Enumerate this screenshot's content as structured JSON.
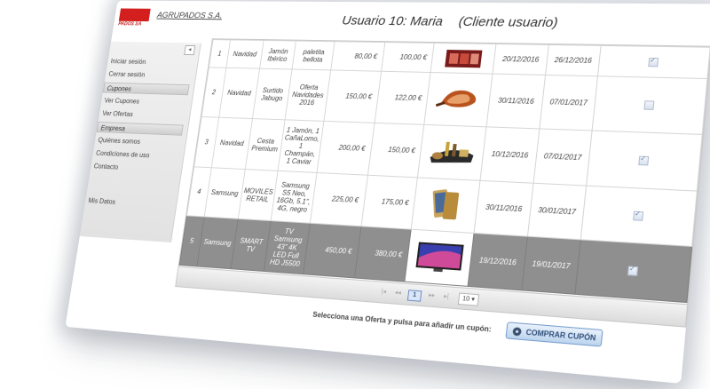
{
  "header": {
    "company": "AGRUPADOS S.A.",
    "logo_sub": "PADOS SA",
    "user": "Usuario 10: Maria",
    "role": "(Cliente usuario)"
  },
  "sidebar": {
    "collapse": "◂",
    "items": [
      {
        "label": "Iniciar sesión"
      },
      {
        "label": "Cerrar sesión"
      },
      {
        "label": "Cupones",
        "header": true
      },
      {
        "label": "Ver Cupones"
      },
      {
        "label": "Ver Ofertas"
      },
      {
        "label": "Empresa",
        "header": true
      },
      {
        "label": "Quiénes somos"
      },
      {
        "label": "Condiciones de uso"
      },
      {
        "label": "Contacto"
      },
      {
        "label": "Mis Datos"
      }
    ]
  },
  "table": {
    "rows": [
      {
        "id": "1",
        "category": "Navidad",
        "product": "Jamón Ibérico",
        "offer": "paletita bellota",
        "price": "80,00 €",
        "discount": "100,00 €",
        "image": "ham-pack-icon",
        "start": "20/12/2016",
        "end": "26/12/2016",
        "checked": true,
        "selected": false
      },
      {
        "id": "2",
        "category": "Navidad",
        "product": "Surtido Jabugo",
        "offer": "Oferta Navidades 2016",
        "price": "150,00 €",
        "discount": "122,00 €",
        "image": "ham-leg-icon",
        "start": "30/11/2016",
        "end": "07/01/2017",
        "checked": false,
        "selected": false
      },
      {
        "id": "3",
        "category": "Navidad",
        "product": "Cesta Premium",
        "offer": "1 Jamón, 1 CañaLomo, 1 Champán, 1 Caviar",
        "price": "200,00 €",
        "discount": "150,00 €",
        "image": "gift-basket-icon",
        "start": "10/12/2016",
        "end": "07/01/2017",
        "checked": true,
        "selected": false
      },
      {
        "id": "4",
        "category": "Samsung",
        "product": "MOVILES RETAIL",
        "offer": "Samsung S5 Neo, 16Gb, 5.1\", 4G, negro",
        "price": "225,00 €",
        "discount": "175,00 €",
        "image": "smartphone-icon",
        "start": "30/11/2016",
        "end": "30/01/2017",
        "checked": true,
        "selected": false
      },
      {
        "id": "5",
        "category": "Samsung",
        "product": "SMART TV",
        "offer": "TV Samsung 43\" 4K LED Full HD J5500",
        "price": "450,00 €",
        "discount": "380,00 €",
        "image": "tv-icon",
        "start": "19/12/2016",
        "end": "19/01/2017",
        "checked": true,
        "selected": true
      }
    ]
  },
  "pager": {
    "first": "|◂",
    "prev": "◂◂",
    "current": "1",
    "next": "▸▸",
    "last": "▸|",
    "per_page": "10 ▾"
  },
  "footer": {
    "instruction": "Selecciona una Oferta y pulsa para añadir un cupón:",
    "buy_label": "COMPRAR CUPÓN"
  }
}
